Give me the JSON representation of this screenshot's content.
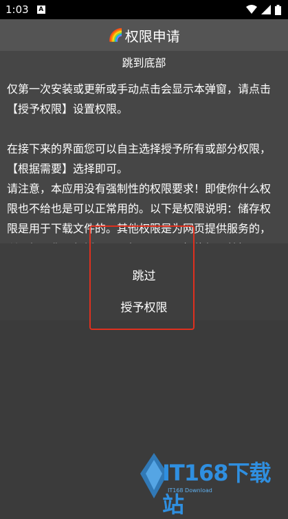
{
  "status": {
    "time": "1:03",
    "notif_letter": "A"
  },
  "dialog": {
    "title": "权限申请",
    "title_icon": "🌈",
    "jump_bottom": "跳到底部",
    "paragraphs": "仅第一次安装或更新或手动点击会显示本弹窗，请点击\n【授予权限】设置权限。\n\n在接下来的界面您可以自主选择授予所有或部分权限，\n【根据需要】选择即可。\n请注意，本应用没有强制性的权限要求！即使你什么权\n限也不给也是可以正常用的。以下是权限说明：储存权\n限是用于下载文件的。其他权限是为网页提供服务的，\n所以如果你不想授予网页权限只需要拒绝权限就好了。",
    "skip_label": "跳过",
    "grant_label": "授予权限"
  },
  "watermark": {
    "main": "IT168下载站",
    "sub": "IT168 Download"
  },
  "colors": {
    "highlight": "#e0301e",
    "watermark": "#2f8fe0"
  }
}
